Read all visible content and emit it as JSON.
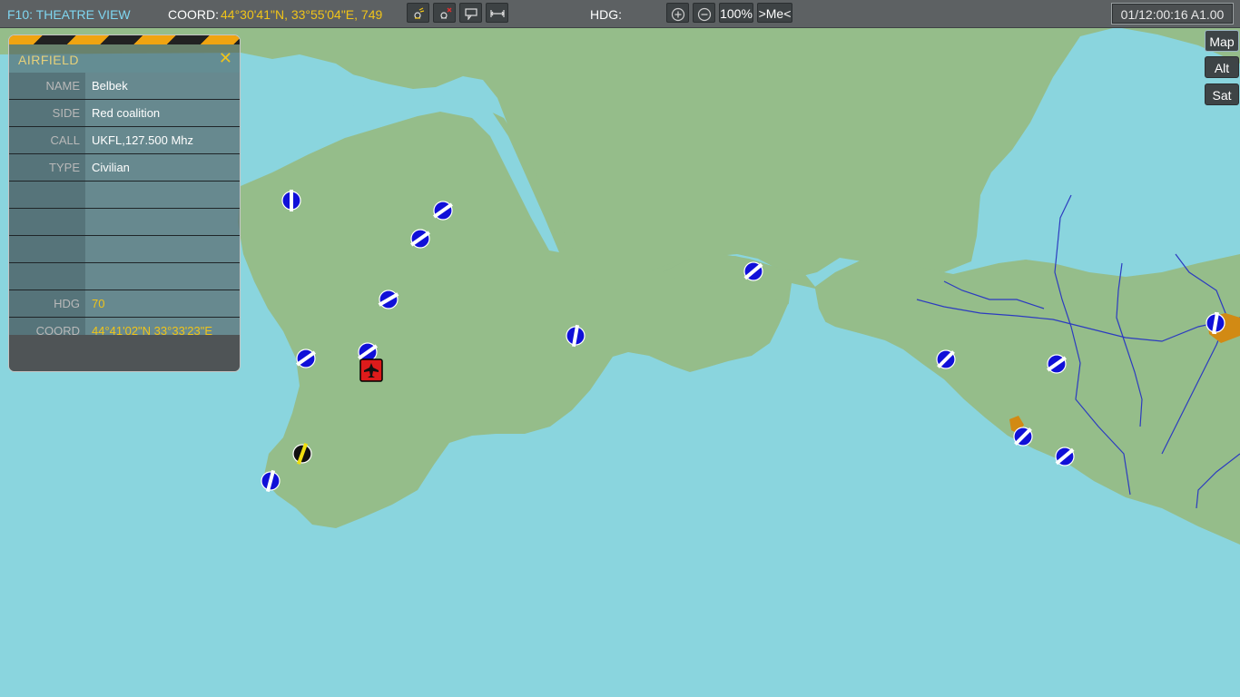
{
  "topbar": {
    "title": "F10: THEATRE VIEW",
    "coord_label": "COORD:",
    "coord_value": "44°30'41\"N, 33°55'04\"E, 749",
    "hdg_label": "HDG:",
    "zoom": "100%",
    "me_button": ">Me<",
    "clock": "01/12:00:16 A1.00",
    "tool_icons": [
      "satellite-icon",
      "satellite-off-icon",
      "comment-icon",
      "ruler-icon"
    ]
  },
  "map_modes": [
    "Map",
    "Alt",
    "Sat"
  ],
  "panel": {
    "title": "AIRFIELD",
    "rows": [
      {
        "label": "NAME",
        "value": "Belbek"
      },
      {
        "label": "SIDE",
        "value": "Red  coalition"
      },
      {
        "label": "CALL",
        "value": "UKFL,127.500 Mhz"
      },
      {
        "label": "TYPE",
        "value": "Civilian"
      },
      {
        "label": "",
        "value": ""
      },
      {
        "label": "",
        "value": ""
      },
      {
        "label": "",
        "value": ""
      },
      {
        "label": "",
        "value": ""
      },
      {
        "label": "HDG",
        "value": "70"
      },
      {
        "label": "COORD",
        "value": "44°41'02\"N  33°33'23\"E"
      }
    ]
  },
  "colors": {
    "sea": "#8ad5de",
    "land": "#95bd8a",
    "river": "#2c3bc0",
    "airfield_blue": "#1010d8",
    "airfield_neutral": "#111111",
    "highlight_yellow": "#f0e010",
    "unit_red": "#dd1b1b",
    "town_orange": "#d28a14",
    "title_cyan": "#7fd6f0",
    "value_yellow": "#f0c419"
  },
  "airfields": [
    {
      "name": "airfield-1",
      "type": "blue",
      "hdg": 90
    },
    {
      "name": "airfield-2",
      "type": "blue",
      "hdg": 35
    },
    {
      "name": "airfield-3",
      "type": "blue",
      "hdg": 35
    },
    {
      "name": "airfield-4",
      "type": "blue",
      "hdg": 30
    },
    {
      "name": "airfield-5",
      "type": "blue",
      "hdg": 80
    },
    {
      "name": "airfield-6",
      "type": "blue",
      "hdg": 35
    },
    {
      "name": "airfield-7",
      "type": "blue",
      "hdg": 35
    },
    {
      "name": "airfield-8",
      "type": "blue",
      "hdg": 75
    },
    {
      "name": "airfield-belbek",
      "type": "neutral",
      "hdg": 70
    },
    {
      "name": "airfield-10",
      "type": "blue",
      "hdg": 40
    },
    {
      "name": "airfield-11",
      "type": "blue",
      "hdg": 45
    },
    {
      "name": "airfield-12",
      "type": "blue",
      "hdg": 35
    },
    {
      "name": "airfield-13",
      "type": "blue",
      "hdg": 45
    },
    {
      "name": "airfield-14",
      "type": "blue",
      "hdg": 40
    },
    {
      "name": "airfield-15",
      "type": "blue",
      "hdg": 85
    },
    {
      "name": "airfield-16",
      "type": "blue",
      "hdg": 80
    }
  ],
  "units": [
    {
      "name": "red-aircraft-unit",
      "icon": "jet-icon"
    }
  ]
}
